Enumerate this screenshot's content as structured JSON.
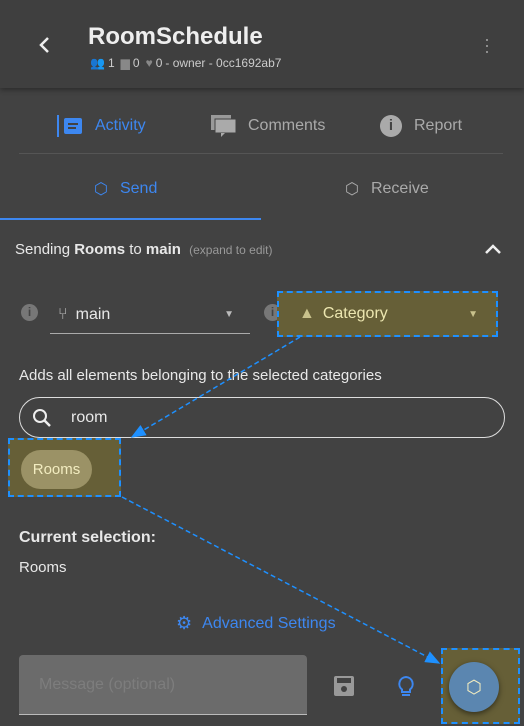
{
  "header": {
    "title": "RoomSchedule",
    "collaborators": "1",
    "comments": "0",
    "likes": "0",
    "meta_suffix": " - owner - 0cc1692ab7"
  },
  "tabs": [
    {
      "label": "Activity",
      "icon": "activity-icon"
    },
    {
      "label": "Comments",
      "icon": "comments-icon"
    },
    {
      "label": "Report",
      "icon": "info-icon"
    }
  ],
  "mode_tabs": [
    {
      "label": "Send",
      "active": true
    },
    {
      "label": "Receive"
    }
  ],
  "summary": {
    "prefix": "Sending ",
    "stream": "Rooms",
    "middle": " to ",
    "branch": "main",
    "hint": "(expand to edit)"
  },
  "branch_select": {
    "value": "main"
  },
  "filter_select": {
    "value": "Category"
  },
  "helper_text": "Adds all elements belonging to the selected categories",
  "search": {
    "value": "room"
  },
  "chips": [
    "Rooms"
  ],
  "current_selection": {
    "label": "Current selection:",
    "value": "Rooms"
  },
  "advanced_settings": "Advanced Settings",
  "message": {
    "placeholder": "Message (optional)"
  },
  "colors": {
    "accent": "#3d87f0",
    "highlight": "#665f37",
    "annotation": "#1e90ff",
    "fab": "#5b86b0"
  }
}
